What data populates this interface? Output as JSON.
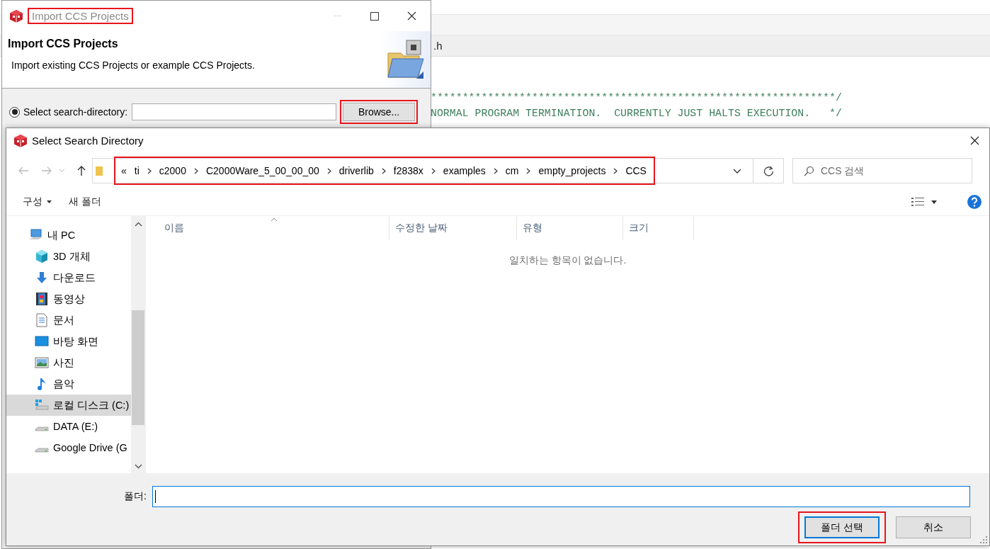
{
  "ide": {
    "tab_label": ".h",
    "code_lines": [
      "****************************************************************/",
      "NORMAL PROGRAM TERMINATION.  CURRENTLY JUST HALTS EXECUTION.   */"
    ]
  },
  "import_dialog": {
    "title": "Import CCS Projects",
    "heading": "Import CCS Projects",
    "description": "Import existing CCS Projects or example CCS Projects.",
    "search_directory": {
      "label": "Select search-directory:",
      "selected": true
    },
    "browse_button": "Browse..."
  },
  "folder_dialog": {
    "title": "Select Search Directory",
    "address": {
      "overflow": "«",
      "segments": [
        "ti",
        "c2000",
        "C2000Ware_5_00_00_00",
        "driverlib",
        "f2838x",
        "examples",
        "cm",
        "empty_projects",
        "CCS"
      ]
    },
    "search": {
      "placeholder": "CCS 검색"
    },
    "toolbar": {
      "organize": "구성",
      "new_folder": "새 폴더"
    },
    "nav_tree": [
      {
        "label": "내 PC",
        "kind": "pc",
        "selected": false,
        "children": [
          {
            "label": "3D 개체",
            "kind": "cube",
            "selected": false
          },
          {
            "label": "다운로드",
            "kind": "download",
            "selected": false
          },
          {
            "label": "동영상",
            "kind": "video",
            "selected": false
          },
          {
            "label": "문서",
            "kind": "document",
            "selected": false
          },
          {
            "label": "바탕 화면",
            "kind": "desktop",
            "selected": false
          },
          {
            "label": "사진",
            "kind": "photo",
            "selected": false
          },
          {
            "label": "음악",
            "kind": "music",
            "selected": false
          },
          {
            "label": "로컬 디스크 (C:)",
            "kind": "system-drive",
            "selected": true
          },
          {
            "label": "DATA (E:)",
            "kind": "drive",
            "selected": false
          },
          {
            "label": "Google Drive (G",
            "kind": "drive",
            "selected": false
          }
        ]
      }
    ],
    "columns": [
      {
        "label": "이름",
        "sorted": true
      },
      {
        "label": "수정한 날짜",
        "sorted": false
      },
      {
        "label": "유형",
        "sorted": false
      },
      {
        "label": "크기",
        "sorted": false
      }
    ],
    "empty_message": "일치하는 항목이 없습니다.",
    "folder_field": {
      "label": "폴더:",
      "focused": true
    },
    "buttons": [
      {
        "label": "폴더 선택",
        "default": true
      },
      {
        "label": "취소",
        "default": false
      }
    ]
  }
}
